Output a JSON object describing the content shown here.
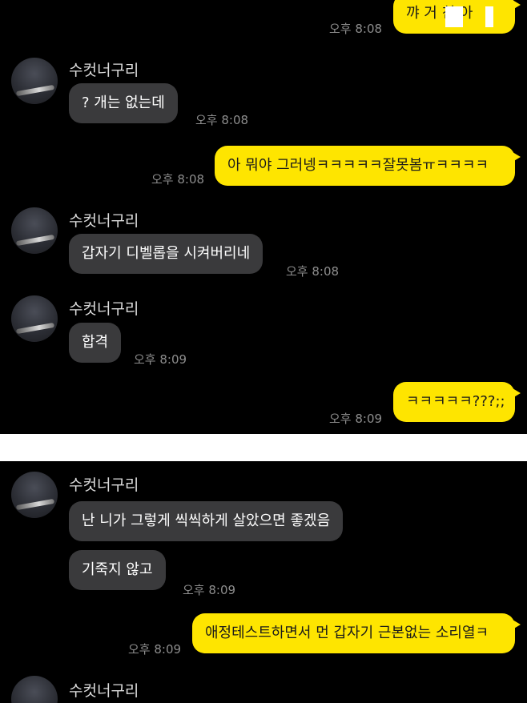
{
  "panel1": {
    "messages": [
      {
        "text": "꺄 거 친 아",
        "time": "오후 8:08"
      },
      {
        "sender": "수컷너구리",
        "text": "? 개는 없는데",
        "time": "오후 8:08"
      },
      {
        "text": "아 뭐야 그러넹ㅋㅋㅋㅋㅋ잘못봄ㅠㅋㅋㅋㅋ",
        "time": "오후 8:08"
      },
      {
        "sender": "수컷너구리",
        "text": "갑자기 디벨롭을 시켜버리네",
        "time": "오후 8:08"
      },
      {
        "sender": "수컷너구리",
        "text": "합격",
        "time": "오후 8:09"
      },
      {
        "text": "ㅋㅋㅋㅋㅋ???;;",
        "time": "오후 8:09"
      }
    ]
  },
  "panel2": {
    "messages": [
      {
        "sender": "수컷너구리",
        "text": "난 니가 그렇게 씩씩하게 살았으면 좋겠음"
      },
      {
        "text": "기죽지 않고",
        "time": "오후 8:09"
      },
      {
        "text": "애정테스트하면서 먼 갑자기 근본없는 소리열ㅋ",
        "time": "오후 8:09"
      },
      {
        "sender": "수컷너구리"
      }
    ]
  },
  "colors": {
    "background": "#000000",
    "my_bubble": "#fee500",
    "their_bubble": "#3a3a3c",
    "timestamp": "#8d8d8d"
  }
}
